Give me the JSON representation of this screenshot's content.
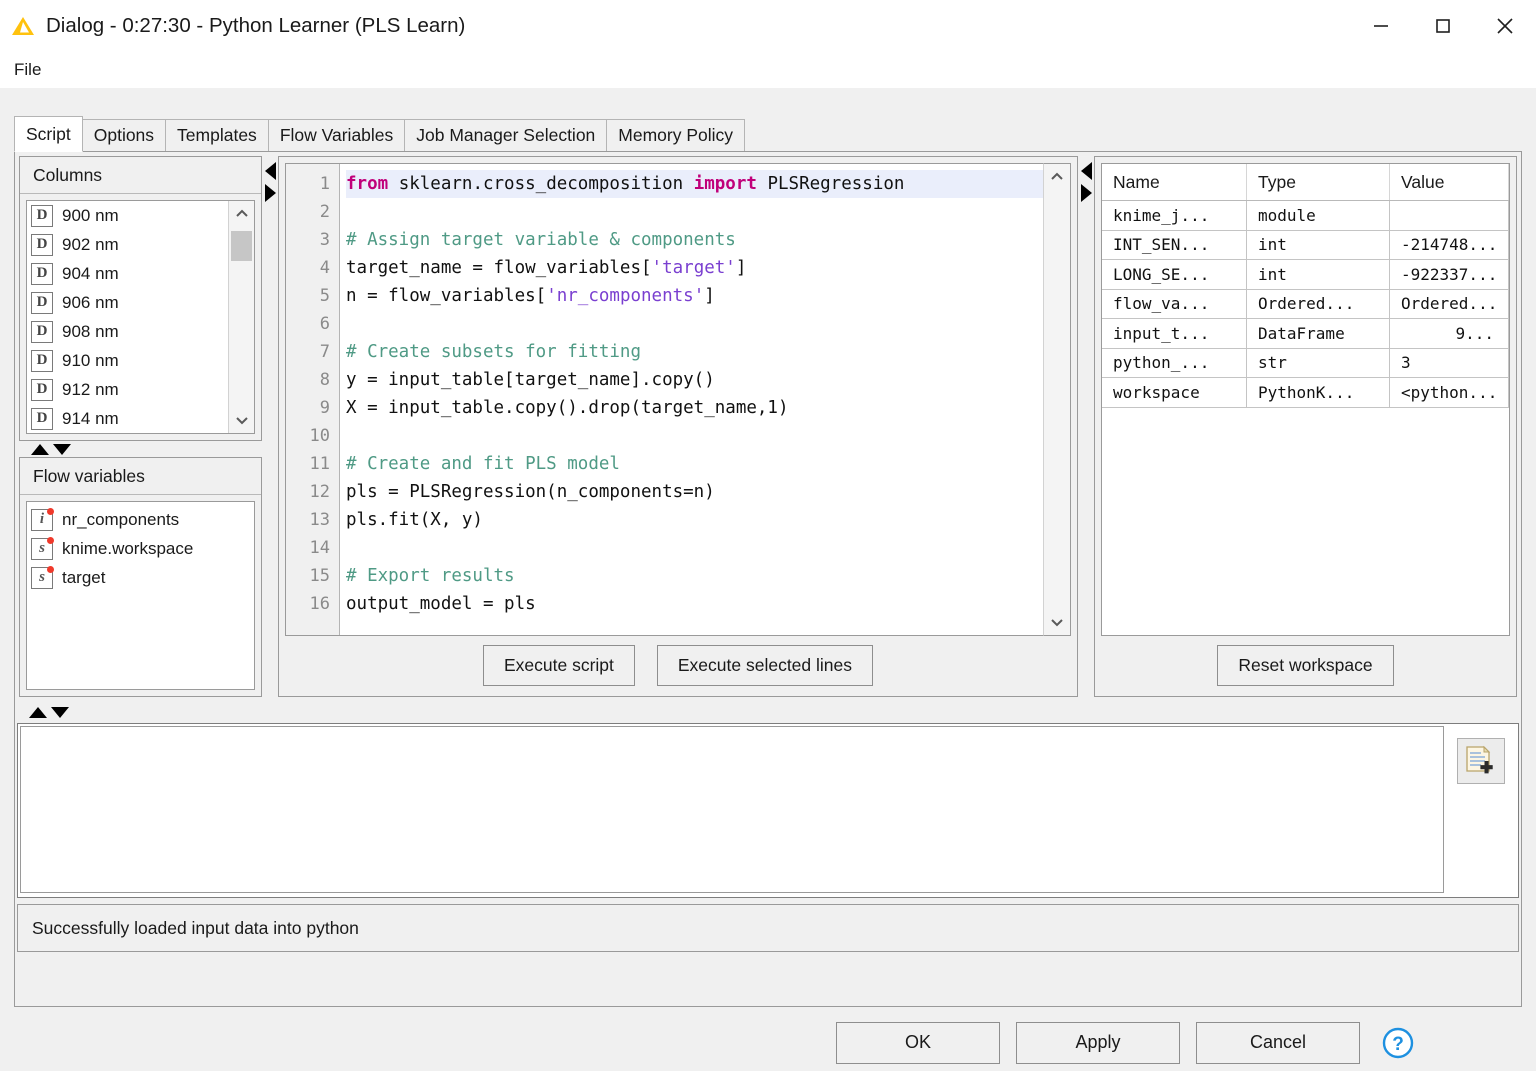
{
  "window": {
    "title": "Dialog - 0:27:30 - Python Learner (PLS Learn)",
    "app_icon": "knime-triangle-icon",
    "controls": {
      "minimize": "minimize-icon",
      "maximize": "maximize-icon",
      "close": "close-icon"
    }
  },
  "menubar": {
    "items": [
      {
        "label": "File"
      }
    ]
  },
  "tabs": [
    {
      "label": "Script",
      "active": true
    },
    {
      "label": "Options",
      "active": false
    },
    {
      "label": "Templates",
      "active": false
    },
    {
      "label": "Flow Variables",
      "active": false
    },
    {
      "label": "Job Manager Selection",
      "active": false
    },
    {
      "label": "Memory Policy",
      "active": false
    }
  ],
  "columns_panel": {
    "title": "Columns",
    "items": [
      {
        "icon": "D",
        "label": "900 nm"
      },
      {
        "icon": "D",
        "label": "902 nm"
      },
      {
        "icon": "D",
        "label": "904 nm"
      },
      {
        "icon": "D",
        "label": "906 nm"
      },
      {
        "icon": "D",
        "label": "908 nm"
      },
      {
        "icon": "D",
        "label": "910 nm"
      },
      {
        "icon": "D",
        "label": "912 nm"
      },
      {
        "icon": "D",
        "label": "914 nm"
      }
    ]
  },
  "flow_panel": {
    "title": "Flow variables",
    "items": [
      {
        "icon": "i",
        "label": "nr_components"
      },
      {
        "icon": "s",
        "label": "knime.workspace"
      },
      {
        "icon": "s",
        "label": "target"
      }
    ]
  },
  "editor": {
    "lines": [
      {
        "n": "1",
        "current": true,
        "tokens": [
          {
            "t": "kw",
            "v": "from"
          },
          {
            "t": "pl",
            "v": " sklearn.cross_decomposition "
          },
          {
            "t": "kw",
            "v": "import"
          },
          {
            "t": "pl",
            "v": " PLSRegression"
          }
        ]
      },
      {
        "n": "2",
        "current": false,
        "tokens": []
      },
      {
        "n": "3",
        "current": false,
        "tokens": [
          {
            "t": "cm",
            "v": "# Assign target variable & components"
          }
        ]
      },
      {
        "n": "4",
        "current": false,
        "tokens": [
          {
            "t": "pl",
            "v": "target_name = flow_variables["
          },
          {
            "t": "st",
            "v": "'target'"
          },
          {
            "t": "pl",
            "v": "]"
          }
        ]
      },
      {
        "n": "5",
        "current": false,
        "tokens": [
          {
            "t": "pl",
            "v": "n = flow_variables["
          },
          {
            "t": "st",
            "v": "'nr_components'"
          },
          {
            "t": "pl",
            "v": "]"
          }
        ]
      },
      {
        "n": "6",
        "current": false,
        "tokens": []
      },
      {
        "n": "7",
        "current": false,
        "tokens": [
          {
            "t": "cm",
            "v": "# Create subsets for fitting"
          }
        ]
      },
      {
        "n": "8",
        "current": false,
        "tokens": [
          {
            "t": "pl",
            "v": "y = input_table[target_name].copy()"
          }
        ]
      },
      {
        "n": "9",
        "current": false,
        "tokens": [
          {
            "t": "pl",
            "v": "X = input_table.copy().drop(target_name,1)"
          }
        ]
      },
      {
        "n": "10",
        "current": false,
        "tokens": []
      },
      {
        "n": "11",
        "current": false,
        "tokens": [
          {
            "t": "cm",
            "v": "# Create and fit PLS model"
          }
        ]
      },
      {
        "n": "12",
        "current": false,
        "tokens": [
          {
            "t": "pl",
            "v": "pls = PLSRegression(n_components=n)"
          }
        ]
      },
      {
        "n": "13",
        "current": false,
        "tokens": [
          {
            "t": "pl",
            "v": "pls.fit(X, y)"
          }
        ]
      },
      {
        "n": "14",
        "current": false,
        "tokens": []
      },
      {
        "n": "15",
        "current": false,
        "tokens": [
          {
            "t": "cm",
            "v": "# Export results"
          }
        ]
      },
      {
        "n": "16",
        "current": false,
        "tokens": [
          {
            "t": "pl",
            "v": "output_model = pls"
          }
        ]
      }
    ],
    "execute_script_label": "Execute script",
    "execute_selected_label": "Execute selected lines"
  },
  "workspace": {
    "headers": [
      "Name",
      "Type",
      "Value"
    ],
    "rows": [
      {
        "name": "knime_j...",
        "type": "module",
        "value": "",
        "numeric": false
      },
      {
        "name": "INT_SEN...",
        "type": "int",
        "value": "-214748...",
        "numeric": false
      },
      {
        "name": "LONG_SE...",
        "type": "int",
        "value": "-922337...",
        "numeric": false
      },
      {
        "name": "flow_va...",
        "type": "Ordered...",
        "value": "Ordered...",
        "numeric": false
      },
      {
        "name": "input_t...",
        "type": "DataFrame",
        "value": "9...",
        "numeric": true
      },
      {
        "name": "python_...",
        "type": "str",
        "value": "3",
        "numeric": false
      },
      {
        "name": "workspace",
        "type": "PythonK...",
        "value": "<python...",
        "numeric": false
      }
    ],
    "reset_label": "Reset workspace"
  },
  "console": {
    "text": "",
    "clear_icon": "clear-console-icon"
  },
  "status": {
    "text": "Successfully loaded input data into python"
  },
  "footer": {
    "ok": "OK",
    "apply": "Apply",
    "cancel": "Cancel",
    "help_icon": "help-icon"
  },
  "colors": {
    "accent_help": "#1e90e0",
    "keyword": "#c0007a",
    "comment": "#4f9a85",
    "string": "#7a3fd0",
    "flow_dot": "#f0392b",
    "dialog_bg": "#f0f0f0"
  }
}
